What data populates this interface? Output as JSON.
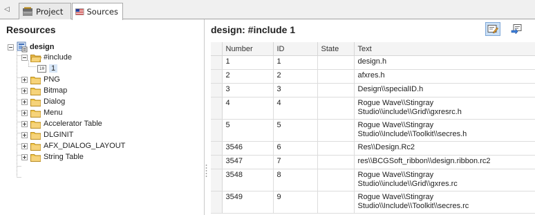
{
  "tabs": [
    {
      "label": "Project",
      "icon": "project-icon",
      "active": false
    },
    {
      "label": "Sources",
      "icon": "sources-icon",
      "active": true
    }
  ],
  "left_pane": {
    "title": "Resources",
    "tree": {
      "root": "design",
      "include_folder": "#include",
      "include_child": "1",
      "folders": [
        "PNG",
        "Bitmap",
        "Dialog",
        "Menu",
        "Accelerator Table",
        "DLGINIT",
        "AFX_DIALOG_LAYOUT",
        "String Table"
      ]
    }
  },
  "right_pane": {
    "title": "design: #include 1",
    "toolbar": [
      "edit-icon",
      "goto-source-icon"
    ],
    "columns": [
      "Number",
      "ID",
      "State",
      "Text"
    ],
    "rows": [
      {
        "number": "1",
        "id": "1",
        "state": "",
        "text": "design.h"
      },
      {
        "number": "2",
        "id": "2",
        "state": "",
        "text": "afxres.h"
      },
      {
        "number": "3",
        "id": "3",
        "state": "",
        "text": "Design\\\\specialID.h"
      },
      {
        "number": "4",
        "id": "4",
        "state": "",
        "text": "Rogue Wave\\\\Stingray Studio\\\\include\\\\Grid\\\\gxresrc.h"
      },
      {
        "number": "5",
        "id": "5",
        "state": "",
        "text": "Rogue Wave\\\\Stingray Studio\\\\Include\\\\Toolkit\\\\secres.h"
      },
      {
        "number": "3546",
        "id": "6",
        "state": "",
        "text": "Res\\\\Design.Rc2"
      },
      {
        "number": "3547",
        "id": "7",
        "state": "",
        "text": "res\\\\BCGSoft_ribbon\\\\design.ribbon.rc2"
      },
      {
        "number": "3548",
        "id": "8",
        "state": "",
        "text": "Rogue Wave\\\\Stingray Studio\\\\include\\\\Grid\\\\gxres.rc"
      },
      {
        "number": "3549",
        "id": "9",
        "state": "",
        "text": "Rogue Wave\\\\Stingray Studio\\\\Include\\\\Toolkit\\\\secres.rc"
      }
    ]
  },
  "colors": {
    "folder": "#f2c94c",
    "selection": "#d7e6f7",
    "toolbar_active": "#c9dff5",
    "header_bg": "#f4f4f4"
  }
}
